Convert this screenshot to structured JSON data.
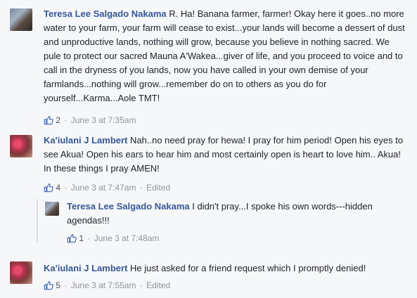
{
  "comments": [
    {
      "author": "Teresa Lee Salgado Nakama",
      "text": " R. Ha! Banana farmer, farmer! Okay here it goes..no more water to your farm, your farm will cease to exist...your lands will become a dessert of dust and unproductive lands, nothing will grow, because you believe in nothing sacred. We pule to protect our sacred Mauna A'Wakea...giver of life, and you proceed to voice and to call in the dryness of you lands, now you have called in your own demise of your farmlands...nothing will grow...remember do on to others as you do for yourself...Karma...Aole TMT!",
      "likes": "2",
      "date": "June 3 at 7:35am",
      "edited": ""
    },
    {
      "author": "Ka'iulani J Lambert",
      "text": " Nah..no need pray for hewa! I pray for him period! Open his eyes to see Akua! Open his ears to hear him and most certainly open is heart to love him.. Akua! In these things I pray AMEN!",
      "likes": "4",
      "date": "June 3 at 7:47am",
      "edited": "Edited"
    },
    {
      "author": "Teresa Lee Salgado Nakama",
      "text": " I didn't pray...I spoke his own words---hidden agendas!!!",
      "likes": "1",
      "date": "June 3 at 7:48am",
      "edited": ""
    },
    {
      "author": "Ka'iulani J Lambert",
      "text": " He just asked for a friend request which I promptly denied!",
      "likes": "5",
      "date": "June 3 at 7:55am",
      "edited": "Edited"
    }
  ],
  "separator": "·",
  "icons": {
    "like": "thumbs-up-icon"
  },
  "colors": {
    "author": "#365899",
    "meta": "#90949c",
    "like": "#4267b2"
  }
}
